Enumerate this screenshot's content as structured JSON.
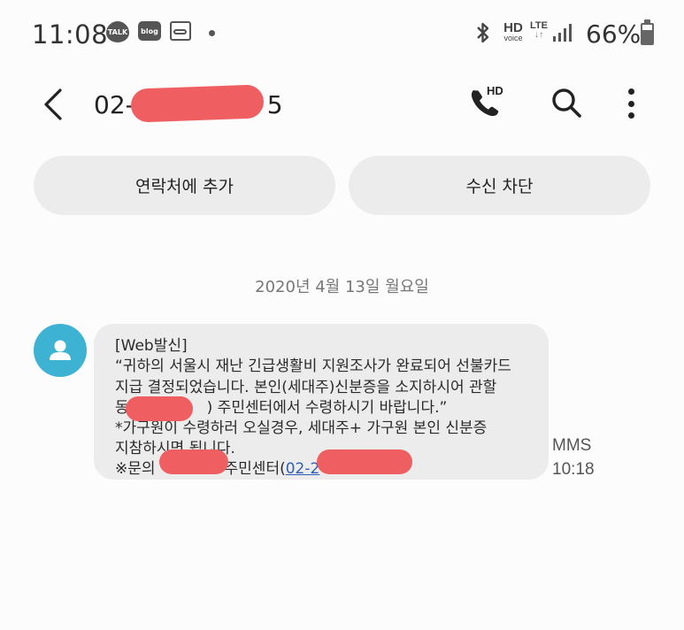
{
  "status_bar": {
    "time": "11:08",
    "notifications": [
      {
        "icon": "kakaotalk-icon",
        "label": "TALK"
      },
      {
        "icon": "blog-icon",
        "label": "blog"
      },
      {
        "icon": "voicemail-icon"
      },
      {
        "icon": "more-notifications-dot-icon"
      }
    ],
    "hd_voice": {
      "big": "HD",
      "small": "voice"
    },
    "network": "LTE",
    "network_arrows": "↓↑",
    "battery": "66%",
    "icons": [
      "bluetooth-icon",
      "signal-icon",
      "battery-icon"
    ]
  },
  "header": {
    "phone_number": "02-",
    "phone_number_tail": "5",
    "hd_call_label": "HD"
  },
  "actions": {
    "add_contact": "연락처에 추가",
    "block": "수신 차단"
  },
  "conversation": {
    "date": "2020년 4월 13일 월요일",
    "messages": [
      {
        "lines": [
          "[Web발신]",
          "“귀하의 서울시 재난 긴급생활비 지원조사가 완료되어 선불카드",
          "지급 결정되었습니다. 본인(세대주)신분증을 소지하시어 관할",
          "동",
          ") 주민센터에서 수령하시기 바랍니다.”",
          "*가구원이 수령하러 오실경우, 세대주+ 가구원 본인 신분증",
          "지참하시면 됩니다.",
          "※문의",
          "주민센터(",
          "02-2"
        ],
        "type": "MMS",
        "time": "10:18"
      }
    ]
  },
  "colors": {
    "background": "#fcfcfc",
    "bubble": "#ececec",
    "avatar": "#3eb2d3",
    "redaction": "#ef5f62",
    "link": "#2f5fb5"
  }
}
